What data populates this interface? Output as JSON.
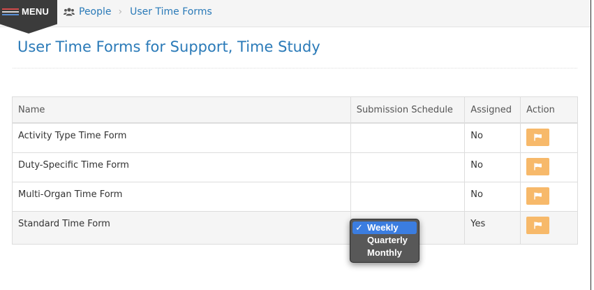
{
  "header": {
    "menu_label": "MENU",
    "breadcrumb": {
      "people_label": "People",
      "current_label": "User Time Forms"
    }
  },
  "page": {
    "title": "User Time Forms for Support, Time Study"
  },
  "table": {
    "columns": {
      "name": "Name",
      "submission_schedule": "Submission Schedule",
      "assigned": "Assigned",
      "action": "Action"
    },
    "rows": [
      {
        "name": "Activity Type Time Form",
        "submission_schedule": "",
        "assigned": "No",
        "action_icon": "flag-icon"
      },
      {
        "name": "Duty-Specific Time Form",
        "submission_schedule": "",
        "assigned": "No",
        "action_icon": "flag-icon"
      },
      {
        "name": "Multi-Organ Time Form",
        "submission_schedule": "",
        "assigned": "No",
        "action_icon": "flag-icon"
      },
      {
        "name": "Standard Time Form",
        "submission_schedule": "Weekly",
        "assigned": "Yes",
        "action_icon": "flag-icon"
      }
    ]
  },
  "schedule_dropdown": {
    "check_glyph": "✓",
    "options": [
      "Weekly",
      "Quarterly",
      "Monthly"
    ],
    "selected": "Weekly"
  },
  "colors": {
    "link_blue": "#2a7ab8",
    "menu_dark": "#3b3b3b",
    "action_orange": "#f7b96a",
    "dropdown_highlight": "#3b7de0",
    "dropdown_bg": "#585858"
  },
  "icons": {
    "menu": "hamburger-icon",
    "people": "people-group-icon",
    "breadcrumb_separator": "chevron-right-icon",
    "action": "flag-icon"
  }
}
